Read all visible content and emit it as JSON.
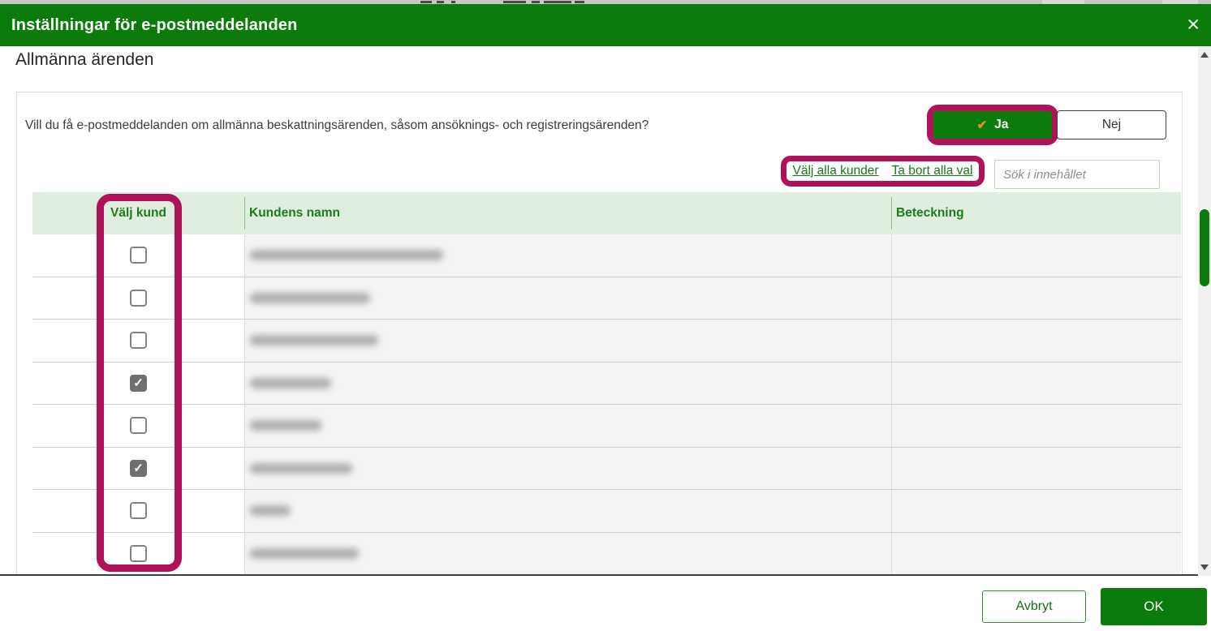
{
  "modal": {
    "title": "Inställningar för e-postmeddelanden",
    "section_title": "Allmänna ärenden",
    "question": "Vill du få e-postmeddelanden om allmänna beskattningsärenden, såsom ansöknings- och registreringsärenden?",
    "yes_button": "Ja",
    "no_button": "Nej",
    "select_all_link": "Välj alla kunder",
    "clear_all_link": "Ta bort alla val",
    "search_placeholder": "Sök i innehållet",
    "cancel_button": "Avbryt",
    "ok_button": "OK"
  },
  "icons": {
    "close_icon": "✕",
    "yes_check_icon": "✔",
    "checkbox_check_icon": "✓"
  },
  "table": {
    "columns": [
      "Välj kund",
      "Kundens namn",
      "Beteckning"
    ],
    "rows": [
      {
        "checked": false,
        "name_redacted": true,
        "name_blur_width": 238,
        "beteckning": ""
      },
      {
        "checked": false,
        "name_redacted": true,
        "name_blur_width": 148,
        "beteckning": ""
      },
      {
        "checked": false,
        "name_redacted": true,
        "name_blur_width": 158,
        "beteckning": ""
      },
      {
        "checked": true,
        "name_redacted": true,
        "name_blur_width": 100,
        "beteckning": ""
      },
      {
        "checked": false,
        "name_redacted": true,
        "name_blur_width": 88,
        "beteckning": ""
      },
      {
        "checked": true,
        "name_redacted": true,
        "name_blur_width": 126,
        "beteckning": ""
      },
      {
        "checked": false,
        "name_redacted": true,
        "name_blur_width": 50,
        "beteckning": ""
      },
      {
        "checked": false,
        "name_redacted": true,
        "name_blur_width": 134,
        "beteckning": ""
      }
    ]
  },
  "colors": {
    "brand_green": "#0b7c0b",
    "annotation_magenta": "#b0125a",
    "check_orange": "#e98f2e",
    "link_green": "#187818",
    "table_header_bg": "#dfeede",
    "checked_checkbox_fill": "#6f6f6f"
  }
}
